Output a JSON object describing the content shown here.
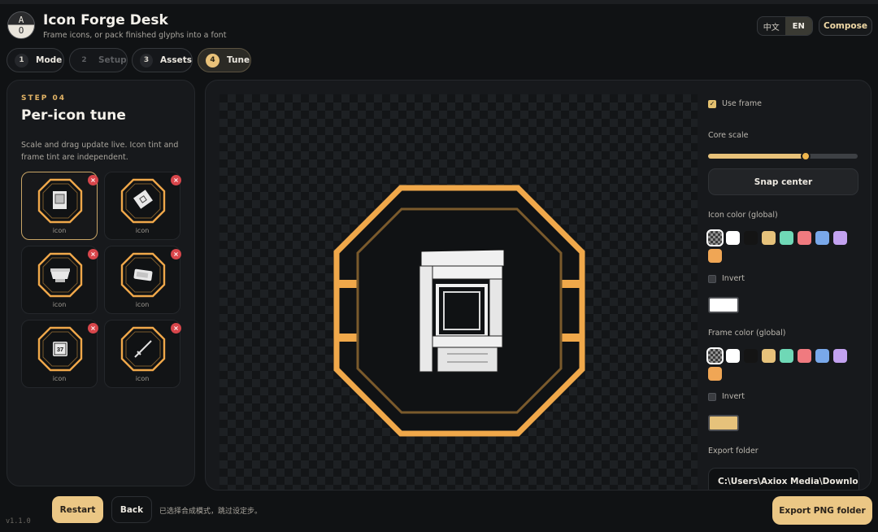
{
  "app": {
    "logo_top": "A",
    "logo_bottom": "O",
    "title": "Icon Forge Desk",
    "subtitle": "Frame icons, or pack finished glyphs into a font"
  },
  "header": {
    "lang_zh": "中文",
    "lang_en": "EN",
    "active_lang": "EN",
    "compose_label": "Compose"
  },
  "steps": [
    {
      "num": "1",
      "label": "Mode",
      "state": "done"
    },
    {
      "num": "2",
      "label": "Setup",
      "state": "disabled"
    },
    {
      "num": "3",
      "label": "Assets",
      "state": "done"
    },
    {
      "num": "4",
      "label": "Tune",
      "state": "active"
    }
  ],
  "left_panel": {
    "step_label": "STEP 04",
    "title": "Per-icon tune",
    "description": "Scale and drag update live. Icon tint and frame tint are independent.",
    "icons": [
      {
        "caption": "icon",
        "glyph": "window-icon",
        "selected": true
      },
      {
        "caption": "icon",
        "glyph": "chip-card-icon",
        "selected": false
      },
      {
        "caption": "icon",
        "glyph": "crate-icon",
        "selected": false
      },
      {
        "caption": "icon",
        "glyph": "device-icon",
        "selected": false
      },
      {
        "caption": "icon",
        "glyph": "cpu-37-icon",
        "chip_text": "37",
        "selected": false
      },
      {
        "caption": "icon",
        "glyph": "sword-icon",
        "selected": false
      }
    ]
  },
  "settings": {
    "use_frame_label": "Use frame",
    "use_frame": true,
    "core_scale_label": "Core scale",
    "core_scale_fraction": 0.65,
    "snap_center_label": "Snap center",
    "icon_color_label": "Icon color (global)",
    "icon_invert_label": "Invert",
    "icon_invert": false,
    "icon_preview_color": "#ffffff",
    "frame_color_label": "Frame color (global)",
    "frame_invert_label": "Invert",
    "frame_invert": false,
    "frame_preview_color": "#e6c27b",
    "palette": [
      "transparent",
      "#ffffff",
      "#141414",
      "#e6c27b",
      "#6fd8b6",
      "#f07a7f",
      "#79a8ea",
      "#c3a2f0",
      "#f0a655"
    ],
    "export_folder_label": "Export folder",
    "export_folder": "C:\\Users\\Axiox Media\\Downloads"
  },
  "preview": {
    "frame_color": "#f0a84a",
    "inner_frame_color": "#7a5a2c"
  },
  "footer": {
    "version": "v1.1.0",
    "restart_label": "Restart",
    "back_label": "Back",
    "status": "已选择合成模式，跳过设定步。",
    "export_label": "Export PNG folder"
  }
}
